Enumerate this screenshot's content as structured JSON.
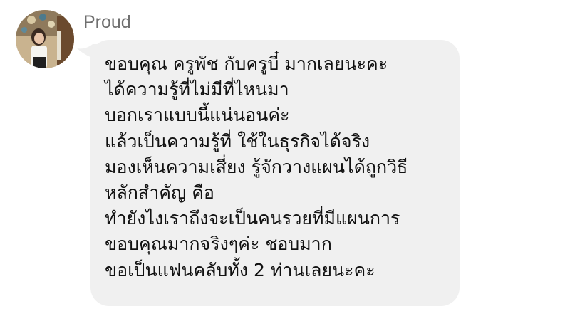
{
  "sender": {
    "name": "Proud"
  },
  "message": {
    "lines": [
      "ขอบคุณ ครูพัช กับครูบี๋ มากเลยนะคะ",
      "ได้ความรู้ที่ไม่มีที่ไหนมา",
      "บอกเราแบบนี้แน่นอนค่ะ",
      "แล้วเป็นความรู้ที่ ใช้ในธุรกิจได้จริง",
      "มองเห็นความเสี่ยง รู้จักวางแผนได้ถูกวิธี",
      "หลักสำคัญ คือ",
      "ทำยังไงเราถึงจะเป็นคนรวยที่มีแผนการ",
      "ขอบคุณมากจริงๆค่ะ ชอบมาก",
      "ขอเป็นแฟนคลับทั้ง 2 ท่านเลยนะคะ"
    ]
  },
  "colors": {
    "bubble_bg": "#f0f0f0",
    "name_text": "#6f6f6f",
    "message_text": "#111111"
  }
}
